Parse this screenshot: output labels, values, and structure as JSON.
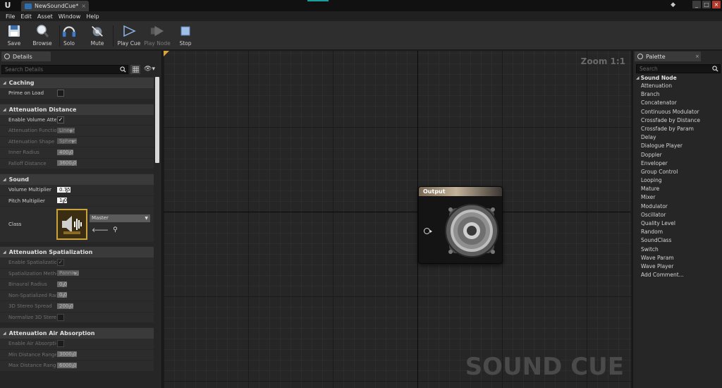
{
  "app": {
    "logo_text": "U",
    "tab_label": "NewSoundCue*",
    "tab_close": "×",
    "window_buttons": [
      "_",
      "□",
      "×"
    ]
  },
  "menu": [
    "File",
    "Edit",
    "Asset",
    "Window",
    "Help"
  ],
  "toolbar": {
    "save": "Save",
    "browse": "Browse",
    "solo": "Solo",
    "mute": "Mute",
    "play_cue": "Play Cue",
    "play_node": "Play Node",
    "stop": "Stop"
  },
  "details": {
    "tab_label": "Details",
    "search_placeholder": "Search Details",
    "eye": "👁▾",
    "categories": {
      "caching": "Caching",
      "attenuation_distance": "Attenuation Distance",
      "sound": "Sound",
      "attenuation_spatialization": "Attenuation Spatialization",
      "attenuation_air_absorption": "Attenuation Air Absorption"
    },
    "prime_on_load": "Prime on Load",
    "enable_volume_atten": "Enable Volume Atter",
    "attenuation_function": {
      "label": "Attenuation Function",
      "value": "Linear"
    },
    "attenuation_shape": {
      "label": "Attenuation Shape",
      "value": "Sphere"
    },
    "inner_radius": {
      "label": "Inner Radius",
      "value": "400.0"
    },
    "falloff_distance": {
      "label": "Falloff Distance",
      "value": "3600.0"
    },
    "volume_multiplier": {
      "label": "Volume Multiplier",
      "value": "0.75"
    },
    "pitch_multiplier": {
      "label": "Pitch Multiplier",
      "value": "1.0"
    },
    "class": {
      "label": "Class",
      "value": "Master"
    },
    "enable_spatialization": "Enable Spatializatio",
    "spatialization_method": {
      "label": "Spatialization Metho",
      "value": "Panning"
    },
    "binaural_radius": {
      "label": "Binaural Radius",
      "value": "0.0"
    },
    "non_spatialized_radius": {
      "label": "Non-Spatialized Rad",
      "value": "0.0"
    },
    "stereo_spread": {
      "label": "3D Stereo Spread",
      "value": "200.0"
    },
    "normalize_stereo": "Normalize 3D Sterec",
    "enable_air_absorption": "Enable Air Absorptio",
    "min_distance_range": {
      "label": "Min Distance Range",
      "value": "3000.0"
    },
    "max_distance_range": {
      "label": "Max Distance Range",
      "value": "6000.0"
    }
  },
  "graph": {
    "zoom": "Zoom 1:1",
    "watermark": "SOUND CUE",
    "node_title": "Output"
  },
  "palette": {
    "tab_label": "Palette",
    "tab_close": "×",
    "search_placeholder": "Search",
    "category": "Sound Node",
    "items": [
      "Attenuation",
      "Branch",
      "Concatenator",
      "Continuous Modulator",
      "Crossfade by Distance",
      "Crossfade by Param",
      "Delay",
      "Dialogue Player",
      "Doppler",
      "Enveloper",
      "Group Control",
      "Looping",
      "Mature",
      "Mixer",
      "Modulator",
      "Oscillator",
      "Quality Level",
      "Random",
      "SoundClass",
      "Switch",
      "Wave Param",
      "Wave Player",
      "Add Comment..."
    ]
  },
  "colors": {
    "accent_teal": "#1a9e9a",
    "corner_orange": "#d9a23a",
    "class_thumb_border": "#caa33a",
    "tab_icon_blue": "#2e6fb4"
  }
}
